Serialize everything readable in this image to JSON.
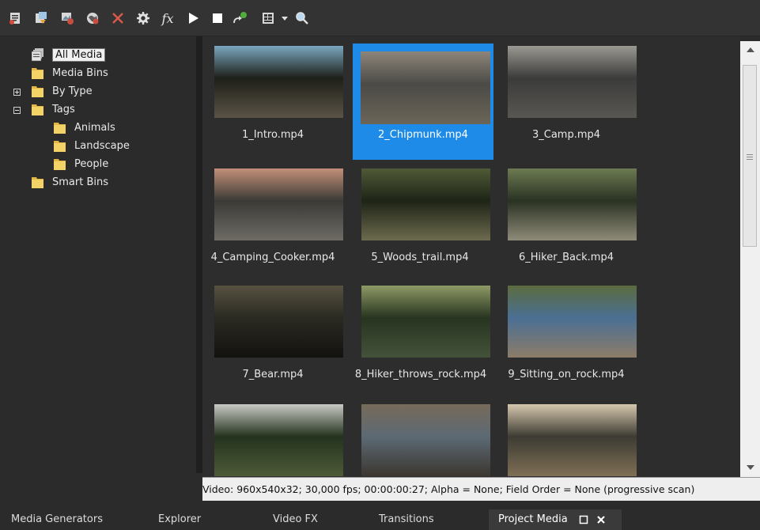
{
  "toolbar": {
    "buttons": [
      {
        "icon": "import-media-icon"
      },
      {
        "icon": "capture-video-icon"
      },
      {
        "icon": "get-photo-icon"
      },
      {
        "icon": "get-media-web-icon"
      },
      {
        "icon": "remove-media-icon"
      },
      {
        "icon": "media-properties-icon"
      },
      {
        "icon": "media-fx-icon"
      },
      {
        "icon": "play-icon"
      },
      {
        "icon": "stop-icon"
      },
      {
        "icon": "auto-preview-icon"
      },
      {
        "icon": "views-icon"
      },
      {
        "icon": "views-dropdown-icon"
      },
      {
        "icon": "search-icon"
      }
    ]
  },
  "tree": {
    "items": [
      {
        "label": "All Media",
        "selected": true
      },
      {
        "label": "Media Bins"
      },
      {
        "label": "By Type",
        "expander": "plus"
      },
      {
        "label": "Tags",
        "expander": "minus"
      },
      {
        "label": "Animals"
      },
      {
        "label": "Landscape"
      },
      {
        "label": "People"
      },
      {
        "label": "Smart Bins"
      }
    ]
  },
  "media": {
    "items": [
      {
        "name": "1_Intro.mp4",
        "colors": [
          "#1d1f18",
          "#7aa6bf",
          "#5b5346"
        ]
      },
      {
        "name": "2_Chipmunk.mp4",
        "colors": [
          "#4b4a46",
          "#8d857a",
          "#6b6558"
        ],
        "selected": true
      },
      {
        "name": "3_Camp.mp4",
        "colors": [
          "#3b3b3a",
          "#9a9891",
          "#595752"
        ]
      },
      {
        "name": "4_Camping_Cooker.mp4",
        "colors": [
          "#3b3a36",
          "#c28f79",
          "#6e6b65"
        ]
      },
      {
        "name": "5_Woods_trail.mp4",
        "colors": [
          "#1e2416",
          "#4f5a37",
          "#6d6a4e"
        ]
      },
      {
        "name": "6_Hiker_Back.mp4",
        "colors": [
          "#2a3222",
          "#6c7a52",
          "#8f8b79"
        ]
      },
      {
        "name": "7_Bear.mp4",
        "colors": [
          "#2a2a22",
          "#57513f",
          "#13120f"
        ]
      },
      {
        "name": "8_Hiker_throws_rock.mp4",
        "colors": [
          "#273420",
          "#8e9a64",
          "#44523a"
        ]
      },
      {
        "name": "9_Sitting_on_rock.mp4",
        "colors": [
          "#4a6f93",
          "#5c6b3e",
          "#8d7c68"
        ]
      },
      {
        "name": "",
        "colors": [
          "#23321d",
          "#c8c9c4",
          "#4e5b38"
        ]
      },
      {
        "name": "",
        "colors": [
          "#5c6a74",
          "#776a5a",
          "#3c3630"
        ]
      },
      {
        "name": "",
        "colors": [
          "#3c3b33",
          "#d6c7ad",
          "#7f6f55"
        ]
      }
    ]
  },
  "status": {
    "text": "Video: 960x540x32; 30,000 fps; 00:00:00:27; Alpha = None; Field Order = None (progressive scan)"
  },
  "tabs": [
    {
      "label": "Media Generators"
    },
    {
      "label": "Explorer"
    },
    {
      "label": "Video FX"
    },
    {
      "label": "Transitions"
    },
    {
      "label": "Project Media",
      "active": true
    }
  ]
}
